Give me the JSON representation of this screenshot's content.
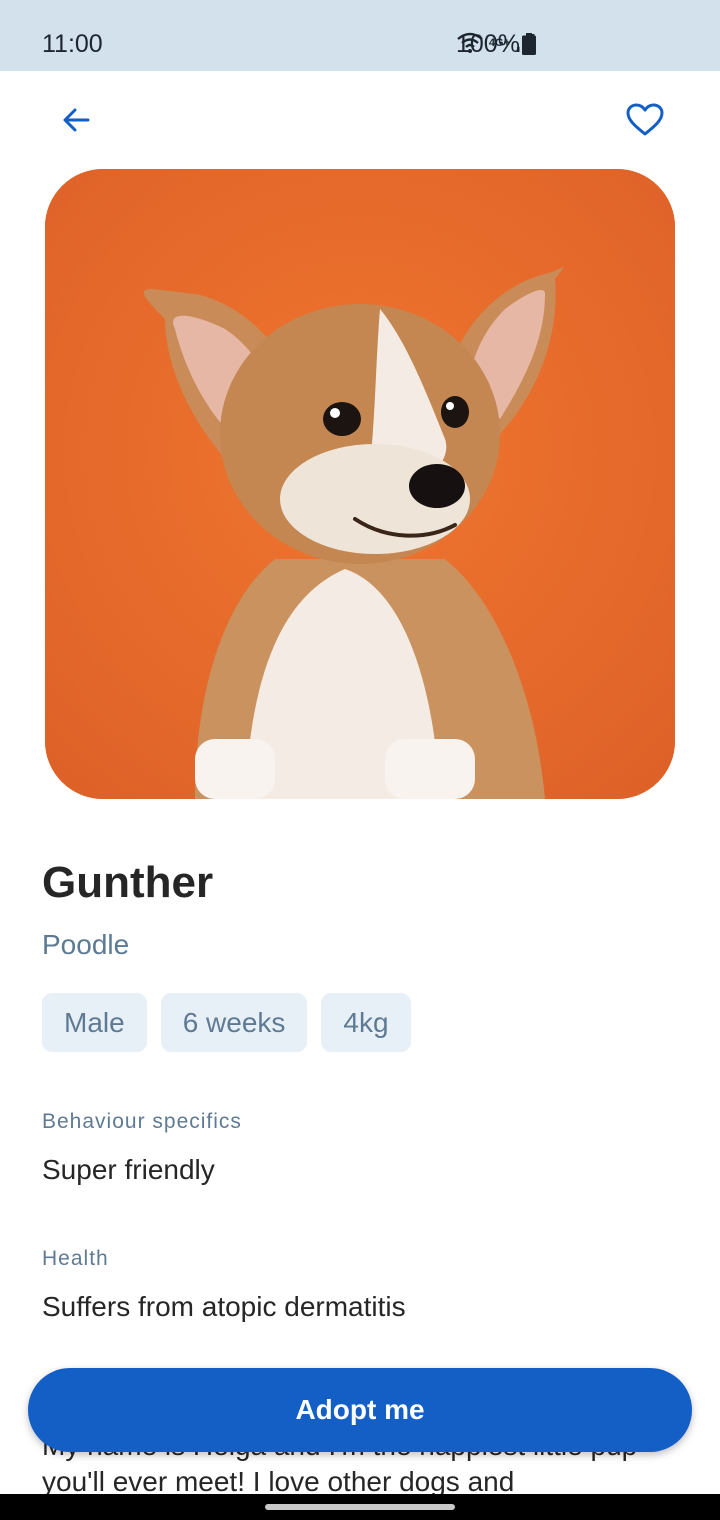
{
  "status_bar": {
    "time": "11:00",
    "network": "4G+",
    "battery": "100%",
    "icons": [
      "wifi-icon",
      "network-4g-icon",
      "signal-icon",
      "battery-icon"
    ]
  },
  "topbar": {
    "back_icon": "arrow-left-icon",
    "favorite_icon": "heart-outline-icon"
  },
  "pet": {
    "name": "Gunther",
    "breed": "Poodle",
    "chips": [
      "Male",
      "6 weeks",
      "4kg"
    ],
    "behaviour_label": "Behaviour specifics",
    "behaviour_value": "Super friendly",
    "health_label": "Health",
    "health_value": "Suffers from atopic dermatitis",
    "description": "My name is Helga and I'm the happiest little pup you'll ever meet! I love other dogs and"
  },
  "actions": {
    "adopt_label": "Adopt me"
  },
  "colors": {
    "accent": "#135fc6",
    "status_bar": "#d3e1ec",
    "chip_bg": "#e8f0f7",
    "muted_text": "#5f7b94",
    "photo_bg": "#e96a2e"
  }
}
